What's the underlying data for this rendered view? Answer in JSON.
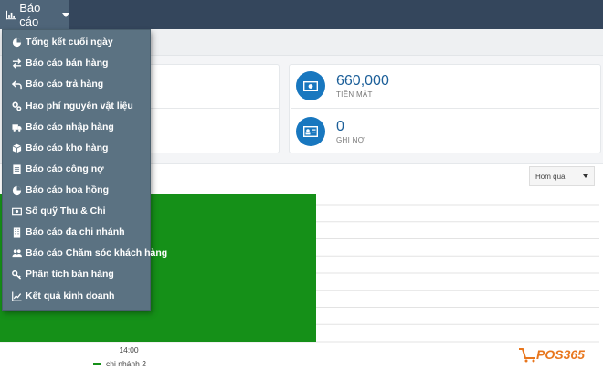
{
  "topbar": {
    "menu_label": "Báo cáo"
  },
  "menu": {
    "items": [
      {
        "label": "Tổng kết cuối ngày",
        "icon": "pie-chart-icon"
      },
      {
        "label": "Báo cáo bán hàng",
        "icon": "exchange-icon"
      },
      {
        "label": "Báo cáo trả hàng",
        "icon": "reply-icon"
      },
      {
        "label": "Hao phí nguyên vật liệu",
        "icon": "cogs-icon"
      },
      {
        "label": "Báo cáo nhập hàng",
        "icon": "truck-icon"
      },
      {
        "label": "Báo cáo kho hàng",
        "icon": "cube-icon"
      },
      {
        "label": "Báo cáo công nợ",
        "icon": "document-icon"
      },
      {
        "label": "Báo cáo hoa hồng",
        "icon": "pie-chart-icon"
      },
      {
        "label": "Sổ quỹ Thu & Chi",
        "icon": "money-icon"
      },
      {
        "label": "Báo cáo đa chi nhánh",
        "icon": "building-icon"
      },
      {
        "label": "Báo cáo Chăm sóc khách hàng",
        "icon": "users-icon"
      },
      {
        "label": "Phân tích bán hàng",
        "icon": "key-icon"
      },
      {
        "label": "Kết quả kinh doanh",
        "icon": "line-chart-icon"
      }
    ]
  },
  "stats": {
    "cash": {
      "value": "660,000",
      "label": "TIỀN MẶT",
      "icon": "money-icon"
    },
    "debt": {
      "value": "0",
      "label": "GHI NỢ",
      "icon": "id-card-icon"
    }
  },
  "filter": {
    "selected": "Hôm qua"
  },
  "chart_data": {
    "type": "bar",
    "categories": [
      "14:00"
    ],
    "series": [
      {
        "name": "chi nhánh 2",
        "values": [
          660000
        ],
        "color": "#159018"
      }
    ]
  },
  "brand": {
    "logo_text": "POS365"
  },
  "colors": {
    "accent": "#1877bf",
    "topbar": "#34465c",
    "menu": "#5b7282",
    "bar": "#159018"
  }
}
